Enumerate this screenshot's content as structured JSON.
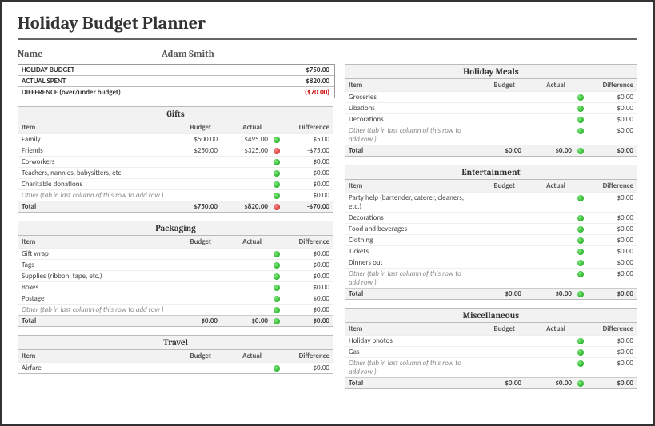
{
  "title": "Holiday Budget Planner",
  "name_label": "Name",
  "name_value": "Adam Smith",
  "summary": {
    "budget_label": "HOLIDAY BUDGET",
    "budget_value": "$750.00",
    "actual_label": "ACTUAL SPENT",
    "actual_value": "$820.00",
    "diff_label": "DIFFERENCE (over/under budget)",
    "diff_value": "($70.00)"
  },
  "head": {
    "item": "Item",
    "budget": "Budget",
    "actual": "Actual",
    "diff": "Difference",
    "total": "Total"
  },
  "other_text": "Other (tab in last column of this row to add row )",
  "sections_left": [
    {
      "title": "Gifts",
      "rows": [
        {
          "item": "Family",
          "b": "$500.00",
          "a": "$495.00",
          "dot": "g",
          "d": "$5.00"
        },
        {
          "item": "Friends",
          "b": "$250.00",
          "a": "$325.00",
          "dot": "r",
          "d": "-$75.00"
        },
        {
          "item": "Co-workers",
          "b": "",
          "a": "",
          "dot": "g",
          "d": "$0.00"
        },
        {
          "item": "Teachers, nannies, babysitters, etc.",
          "b": "",
          "a": "",
          "dot": "g",
          "d": "$0.00"
        },
        {
          "item": "Charitable donations",
          "b": "",
          "a": "",
          "dot": "g",
          "d": "$0.00"
        },
        {
          "item": "__OTHER__",
          "b": "",
          "a": "",
          "dot": "g",
          "d": "$0.00"
        }
      ],
      "total": {
        "b": "$750.00",
        "a": "$820.00",
        "dot": "r",
        "d": "-$70.00"
      }
    },
    {
      "title": "Packaging",
      "rows": [
        {
          "item": "Gift wrap",
          "b": "",
          "a": "",
          "dot": "g",
          "d": "$0.00"
        },
        {
          "item": "Tags",
          "b": "",
          "a": "",
          "dot": "g",
          "d": "$0.00"
        },
        {
          "item": "Supplies (ribbon, tape, etc.)",
          "b": "",
          "a": "",
          "dot": "g",
          "d": "$0.00"
        },
        {
          "item": "Boxes",
          "b": "",
          "a": "",
          "dot": "g",
          "d": "$0.00"
        },
        {
          "item": "Postage",
          "b": "",
          "a": "",
          "dot": "g",
          "d": "$0.00"
        },
        {
          "item": "__OTHER__",
          "b": "",
          "a": "",
          "dot": "g",
          "d": "$0.00"
        }
      ],
      "total": {
        "b": "$0.00",
        "a": "$0.00",
        "dot": "g",
        "d": "$0.00"
      }
    },
    {
      "title": "Travel",
      "rows": [
        {
          "item": "Airfare",
          "b": "",
          "a": "",
          "dot": "g",
          "d": "$0.00"
        }
      ],
      "total": null
    }
  ],
  "sections_right": [
    {
      "title": "Holiday Meals",
      "rows": [
        {
          "item": "Groceries",
          "b": "",
          "a": "",
          "dot": "g",
          "d": "$0.00"
        },
        {
          "item": "Libations",
          "b": "",
          "a": "",
          "dot": "g",
          "d": "$0.00"
        },
        {
          "item": "Decorations",
          "b": "",
          "a": "",
          "dot": "g",
          "d": "$0.00"
        },
        {
          "item": "__OTHER__",
          "b": "",
          "a": "",
          "dot": "g",
          "d": "$0.00"
        }
      ],
      "total": {
        "b": "$0.00",
        "a": "$0.00",
        "dot": "g",
        "d": "$0.00"
      }
    },
    {
      "title": "Entertainment",
      "rows": [
        {
          "item": "Party help (bartender, caterer, cleaners, etc.)",
          "b": "",
          "a": "",
          "dot": "g",
          "d": "$0.00"
        },
        {
          "item": "Decorations",
          "b": "",
          "a": "",
          "dot": "g",
          "d": "$0.00"
        },
        {
          "item": "Food and beverages",
          "b": "",
          "a": "",
          "dot": "g",
          "d": "$0.00"
        },
        {
          "item": "Clothing",
          "b": "",
          "a": "",
          "dot": "g",
          "d": "$0.00"
        },
        {
          "item": "Tickets",
          "b": "",
          "a": "",
          "dot": "g",
          "d": "$0.00"
        },
        {
          "item": "Dinners out",
          "b": "",
          "a": "",
          "dot": "g",
          "d": "$0.00"
        },
        {
          "item": "__OTHER__",
          "b": "",
          "a": "",
          "dot": "g",
          "d": "$0.00"
        }
      ],
      "total": {
        "b": "$0.00",
        "a": "$0.00",
        "dot": "g",
        "d": "$0.00"
      }
    },
    {
      "title": "Miscellaneous",
      "rows": [
        {
          "item": "Holiday photos",
          "b": "",
          "a": "",
          "dot": "g",
          "d": "$0.00"
        },
        {
          "item": "Gas",
          "b": "",
          "a": "",
          "dot": "g",
          "d": "$0.00"
        },
        {
          "item": "__OTHER__",
          "b": "",
          "a": "",
          "dot": "g",
          "d": "$0.00"
        }
      ],
      "total": {
        "b": "$0.00",
        "a": "$0.00",
        "dot": "g",
        "d": "$0.00"
      }
    }
  ]
}
